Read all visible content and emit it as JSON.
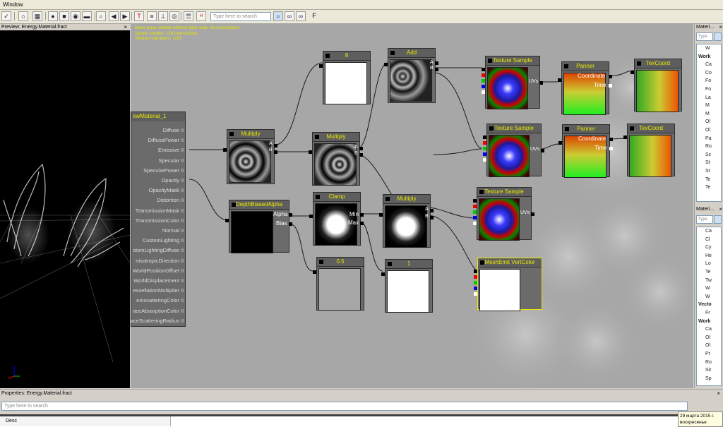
{
  "menu": {
    "window_label": "Window"
  },
  "toolbar": {
    "search_placeholder": "Type here to search",
    "icons": [
      "checkmark-icon",
      "home-icon",
      "grid-icon",
      "sphere-icon",
      "cube-icon",
      "cylinder-icon",
      "plane-icon",
      "search-icon",
      "back-icon",
      "forward-icon",
      "text-icon",
      "stats-icon",
      "vertex-icon",
      "eye-icon",
      "comment-icon",
      "hlsl-icon",
      "binoculars-icon",
      "binoculars-icon",
      "font-icon"
    ]
  },
  "preview": {
    "title": "Preview: Energy.Material.fract",
    "close": "×"
  },
  "canvas": {
    "stats": "Base pass shader without light map: 56 instructions\nVertex shader: 118 instructions\nTexture samplers: 1/16",
    "material_node": {
      "title": "ewMaterial_1",
      "inputs": [
        "Diffuse",
        "DiffusePower",
        "Emissive",
        "Specular",
        "SpecularPower",
        "Opacity",
        "OpacityMask",
        "Distortion",
        "TransmissionMask",
        "TransmissionColor",
        "Normal",
        "CustomLighting",
        "stomLightingDiffuse",
        "nisotropicDirection",
        "WorldPositionOffset",
        "WorldDisplacement",
        "essellationMultiplier",
        "eInscatteringColor",
        "aceAbsorptionColor",
        "aceScatteringRadius"
      ]
    },
    "nodes": {
      "const8": {
        "title": "8"
      },
      "add": {
        "title": "Add",
        "pin_a": "A",
        "pin_b": "B"
      },
      "texsample1": {
        "title": "Texture Sample",
        "uvs": "UVs"
      },
      "panner1": {
        "title": "Panner",
        "coord": "Coordinate",
        "time": "Time"
      },
      "texcoord1": {
        "title": "TexCoord"
      },
      "multiply1": {
        "title": "Multiply",
        "pin_a": "A",
        "pin_b": "B"
      },
      "multiply2": {
        "title": "Multiply",
        "pin_a": "A",
        "pin_b": "B"
      },
      "texsample2": {
        "title": "Texture Sample",
        "uvs": "UVs"
      },
      "panner2": {
        "title": "Panner",
        "coord": "Coordinate",
        "time": "Time"
      },
      "texcoord2": {
        "title": "TexCoord"
      },
      "depthbiased": {
        "title": "DepthBiasedAlpha",
        "alpha": "Alpha",
        "bias": "Bias"
      },
      "clamp": {
        "title": "Clamp",
        "min": "Min",
        "max": "Max"
      },
      "multiply3": {
        "title": "Multiply",
        "pin_a": "A",
        "pin_b": "B"
      },
      "texsample3": {
        "title": "Texture Sample",
        "uvs": "UVs"
      },
      "const05": {
        "title": "0.5"
      },
      "const1": {
        "title": "1"
      },
      "vertcolor": {
        "title": "MeshEmit VertColor"
      }
    }
  },
  "right_panel": {
    "panel1": {
      "title": "Materi...",
      "close": "×",
      "search_placeholder": "Type",
      "items": [
        "W",
        "Work",
        "Ca",
        "Co",
        "Fo",
        "Fo",
        "La",
        "M",
        "M",
        "Ol",
        "Ol",
        "Pa",
        "Ro",
        "Sc",
        "St",
        "St",
        "Te",
        "Te"
      ]
    },
    "panel2": {
      "title": "Materi...",
      "close": "×",
      "search_placeholder": "Type",
      "items": [
        "Ca",
        "Cl",
        "Cy",
        "He",
        "Lo",
        "Te",
        "Tw",
        "W",
        "W",
        "Vecto",
        "Fr",
        "Work",
        "Ca",
        "Ol",
        "Ol",
        "Pr",
        "Ro",
        "Sir",
        "Sp"
      ]
    }
  },
  "properties": {
    "title": "Properties: Energy.Material.fract",
    "close": "×",
    "search_placeholder": "Type here to search",
    "desc_column": "Desc"
  },
  "clock": {
    "date": "29 марта 2015 г.",
    "day": "воскресенье"
  },
  "colors": {
    "canvas_bg": "#a7a7a7",
    "node_title_text": "#e8e800",
    "wire": "#1a1a1a",
    "selected_outline": "#e8e800"
  }
}
